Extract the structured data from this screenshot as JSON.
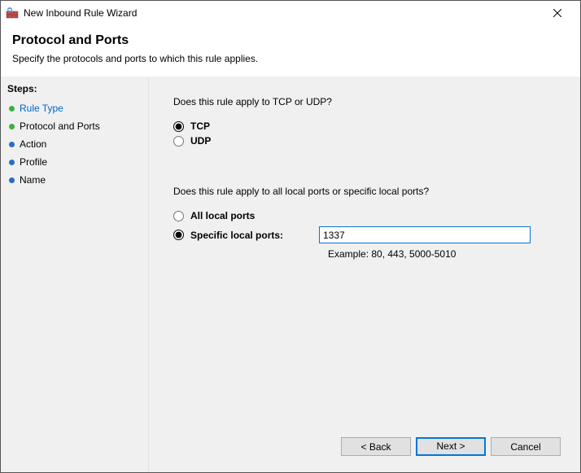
{
  "window": {
    "title": "New Inbound Rule Wizard"
  },
  "header": {
    "title": "Protocol and Ports",
    "subtitle": "Specify the protocols and ports to which this rule applies."
  },
  "sidebar": {
    "label": "Steps:",
    "items": [
      {
        "label": "Rule Type",
        "state": "done"
      },
      {
        "label": "Protocol and Ports",
        "state": "current"
      },
      {
        "label": "Action",
        "state": "pending"
      },
      {
        "label": "Profile",
        "state": "pending"
      },
      {
        "label": "Name",
        "state": "pending"
      }
    ]
  },
  "main": {
    "q1": "Does this rule apply to TCP or UDP?",
    "proto": {
      "tcp_label": "TCP",
      "udp_label": "UDP",
      "selected": "tcp"
    },
    "q2": "Does this rule apply to all local ports or specific local ports?",
    "ports": {
      "all_label": "All local ports",
      "specific_label": "Specific local ports:",
      "selected": "specific",
      "value": "1337",
      "example": "Example: 80, 443, 5000-5010"
    }
  },
  "footer": {
    "back": "< Back",
    "next": "Next >",
    "cancel": "Cancel"
  }
}
